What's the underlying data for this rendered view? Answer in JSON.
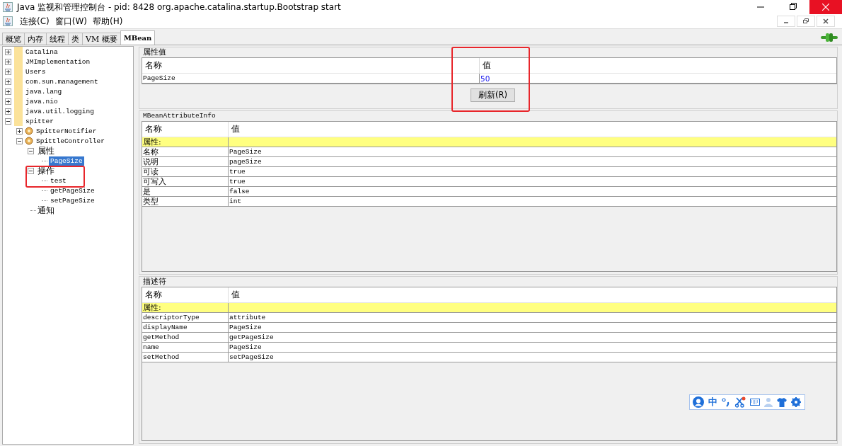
{
  "window": {
    "title": "Java 监视和管理控制台 - pid: 8428 org.apache.catalina.startup.Bootstrap start"
  },
  "menu": [
    {
      "label": "连接(C)"
    },
    {
      "label": "窗口(W)"
    },
    {
      "label": "帮助(H)"
    }
  ],
  "tabs": [
    {
      "label": "概览",
      "selected": false
    },
    {
      "label": "内存",
      "selected": false
    },
    {
      "label": "线程",
      "selected": false
    },
    {
      "label": "类",
      "selected": false
    },
    {
      "label": "VM 概要",
      "selected": false
    },
    {
      "label": "MBean",
      "selected": true
    }
  ],
  "tree": [
    {
      "label": "Catalina",
      "kind": "folder",
      "expanded": false,
      "selected": false
    },
    {
      "label": "JMImplementation",
      "kind": "folder",
      "expanded": false,
      "selected": false
    },
    {
      "label": "Users",
      "kind": "folder",
      "expanded": false,
      "selected": false
    },
    {
      "label": "com.sun.management",
      "kind": "folder",
      "expanded": false,
      "selected": false
    },
    {
      "label": "java.lang",
      "kind": "folder",
      "expanded": false,
      "selected": false
    },
    {
      "label": "java.nio",
      "kind": "folder",
      "expanded": false,
      "selected": false
    },
    {
      "label": "java.util.logging",
      "kind": "folder",
      "expanded": false,
      "selected": false
    },
    {
      "label": "spitter",
      "kind": "folder",
      "expanded": true,
      "selected": false,
      "children": [
        {
          "label": "SpitterNotifier",
          "kind": "bean",
          "expanded": false,
          "selected": false
        },
        {
          "label": "SpittleController",
          "kind": "bean",
          "expanded": true,
          "selected": false,
          "children": [
            {
              "label": "属性",
              "kind": "group",
              "expanded": true,
              "selected": false,
              "children": [
                {
                  "label": "PageSize",
                  "kind": "leaf",
                  "selected": true
                }
              ]
            },
            {
              "label": "操作",
              "kind": "group",
              "expanded": true,
              "selected": false,
              "children": [
                {
                  "label": "test",
                  "kind": "leaf",
                  "selected": false
                },
                {
                  "label": "getPageSize",
                  "kind": "leaf",
                  "selected": false
                },
                {
                  "label": "setPageSize",
                  "kind": "leaf",
                  "selected": false
                }
              ]
            },
            {
              "label": "通知",
              "kind": "group",
              "selected": false
            }
          ]
        }
      ]
    }
  ],
  "attribute_values": {
    "title": "属性值",
    "columns": [
      "名称",
      "值"
    ],
    "rows": [
      {
        "name": "PageSize",
        "value": "50"
      }
    ],
    "refresh_button": "刷新(R)"
  },
  "attribute_info": {
    "title": "MBeanAttributeInfo",
    "columns": [
      "名称",
      "值"
    ],
    "rows": [
      {
        "kind": "header",
        "name": "属性:",
        "value": ""
      },
      {
        "kind": "row",
        "name": "名称",
        "value": "PageSize"
      },
      {
        "kind": "row",
        "name": "说明",
        "value": "pageSize"
      },
      {
        "kind": "row",
        "name": "可读",
        "value": "true"
      },
      {
        "kind": "row",
        "name": "可写入",
        "value": "true"
      },
      {
        "kind": "row",
        "name": "是",
        "value": "false"
      },
      {
        "kind": "row",
        "name": "类型",
        "value": "int"
      }
    ]
  },
  "descriptor": {
    "title": "描述符",
    "columns": [
      "名称",
      "值"
    ],
    "rows": [
      {
        "kind": "header",
        "name": "属性:",
        "value": ""
      },
      {
        "kind": "row",
        "name": "descriptorType",
        "value": "attribute"
      },
      {
        "kind": "row",
        "name": "displayName",
        "value": "PageSize"
      },
      {
        "kind": "row",
        "name": "getMethod",
        "value": "getPageSize"
      },
      {
        "kind": "row",
        "name": "name",
        "value": "PageSize"
      },
      {
        "kind": "row",
        "name": "setMethod",
        "value": "setPageSize"
      }
    ]
  },
  "ime_toolbar": {
    "mode": "中"
  }
}
